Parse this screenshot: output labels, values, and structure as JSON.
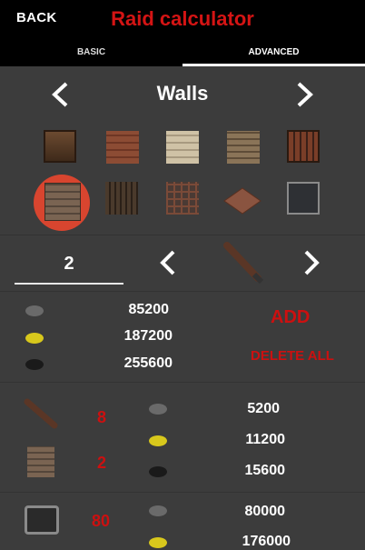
{
  "header": {
    "back_label": "BACK",
    "title": "Raid calculator"
  },
  "tabs": [
    {
      "label": "BASIC"
    },
    {
      "label": "ADVANCED"
    }
  ],
  "category": {
    "title": "Walls"
  },
  "selector": {
    "quantity": "2"
  },
  "totals": {
    "sulfur_stone": "85200",
    "sulfur": "187200",
    "charcoal": "255600"
  },
  "actions": {
    "add_label": "ADD",
    "delete_all_label": "DELETE ALL"
  },
  "entries": [
    {
      "count_item": "8",
      "count_target": "2",
      "stone": "5200",
      "sulfur": "11200",
      "charcoal": "15600"
    },
    {
      "count": "80",
      "stone": "80000",
      "sulfur": "176000"
    }
  ],
  "colors": {
    "accent_red": "#cc1010",
    "selection": "#d8452f",
    "background": "#3c3c3c",
    "topbar": "#000000"
  }
}
